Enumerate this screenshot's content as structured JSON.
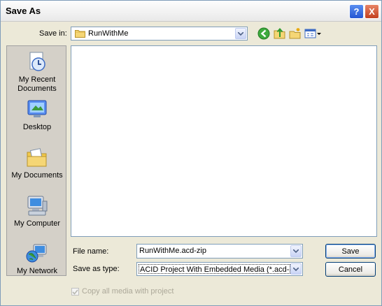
{
  "window": {
    "title": "Save As",
    "help_glyph": "?",
    "close_glyph": "X"
  },
  "toolbar": {
    "save_in_label": "Save in:",
    "current_folder": "RunWithMe",
    "icons": [
      "back-icon",
      "up-folder-icon",
      "new-folder-icon",
      "view-menu-icon"
    ]
  },
  "places": [
    {
      "label_line1": "My Recent",
      "label_line2": "Documents",
      "icon": "recent-documents-icon"
    },
    {
      "label_line1": "Desktop",
      "label_line2": "",
      "icon": "desktop-icon"
    },
    {
      "label_line1": "My Documents",
      "label_line2": "",
      "icon": "my-documents-icon"
    },
    {
      "label_line1": "My Computer",
      "label_line2": "",
      "icon": "my-computer-icon"
    },
    {
      "label_line1": "My Network",
      "label_line2": "",
      "icon": "my-network-icon"
    }
  ],
  "form": {
    "file_name_label": "File name:",
    "file_name_value": "RunWithMe.acd-zip",
    "save_as_type_label": "Save as type:",
    "save_as_type_value": "ACID Project With Embedded Media (*.acd-zip)",
    "save_label": "Save",
    "cancel_label": "Cancel",
    "copy_media_label": "Copy all media with project",
    "copy_media_checked": true
  },
  "colors": {
    "dialog_bg": "#ECE9D8",
    "places_bg": "#D4D0C8",
    "field_border": "#7F9DB9",
    "selection": "#316AC5",
    "button_border": "#003C74"
  }
}
